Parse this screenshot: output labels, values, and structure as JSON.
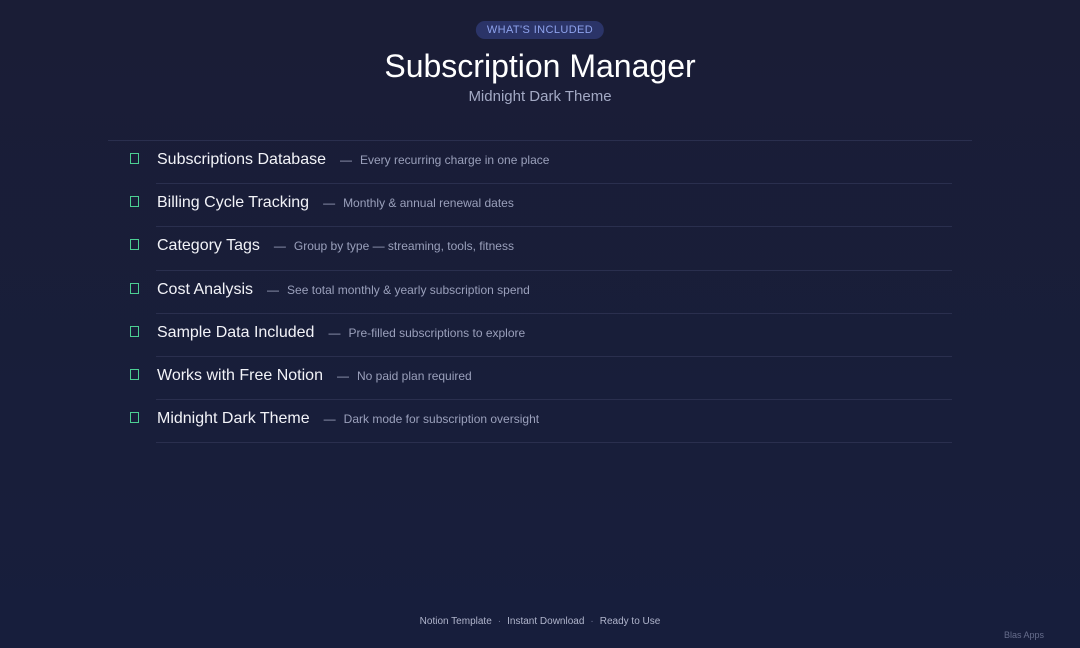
{
  "header": {
    "badge": "WHAT'S INCLUDED",
    "title": "Subscription Manager",
    "subtitle": "Midnight Dark Theme"
  },
  "features": [
    {
      "name": "Subscriptions Database",
      "desc": "Every recurring charge in one place"
    },
    {
      "name": "Billing Cycle Tracking",
      "desc": "Monthly & annual renewal dates"
    },
    {
      "name": "Category Tags",
      "desc": "Group by type — streaming, tools, fitness"
    },
    {
      "name": "Cost Analysis",
      "desc": "See total monthly & yearly subscription spend"
    },
    {
      "name": "Sample Data Included",
      "desc": "Pre-filled subscriptions to explore"
    },
    {
      "name": "Works with Free Notion",
      "desc": "No paid plan required"
    },
    {
      "name": "Midnight Dark Theme",
      "desc": "Dark mode for subscription oversight"
    }
  ],
  "separator": "—",
  "footer": {
    "items": [
      "Notion Template",
      "Instant Download",
      "Ready to Use"
    ],
    "separator": "·"
  },
  "brand": "Blas Apps",
  "icons": {
    "feature_marker": "checkbox-icon"
  },
  "colors": {
    "accent": "#4ccf93",
    "badge_background": "#2b3468",
    "badge_text": "#8ea2ec",
    "background": "#1a1d36"
  }
}
